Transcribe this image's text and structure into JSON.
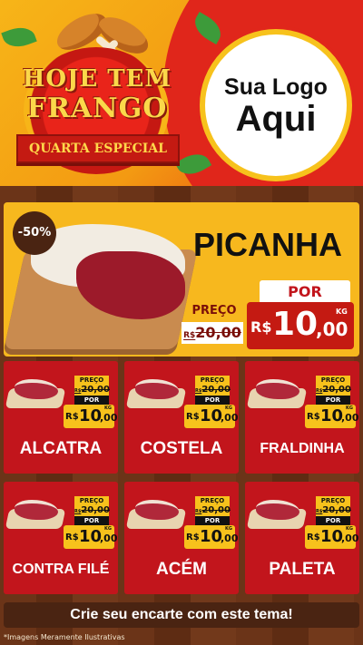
{
  "header": {
    "title_line1": "HOJE TEM",
    "title_line2": "FRANGO",
    "ribbon": "QUARTA ESPECIAL",
    "logo_line1": "Sua Logo",
    "logo_line2": "Aqui"
  },
  "featured": {
    "discount": "-50%",
    "name": "PICANHA",
    "por_label": "POR",
    "preco_label": "PREÇO",
    "old_currency": "R$",
    "old_price": "20,00",
    "currency": "R$",
    "price_int": "10",
    "price_dec": ",00",
    "unit": "KG"
  },
  "products": [
    {
      "name": "ALCATRA",
      "preco_label": "PREÇO",
      "old_currency": "R$",
      "old_price": "20,00",
      "por_label": "POR",
      "currency": "R$",
      "price_int": "10",
      "price_dec": ",00",
      "unit": "KG"
    },
    {
      "name": "COSTELA",
      "preco_label": "PREÇO",
      "old_currency": "R$",
      "old_price": "20,00",
      "por_label": "POR",
      "currency": "R$",
      "price_int": "10",
      "price_dec": ",00",
      "unit": "KG"
    },
    {
      "name": "FRALDINHA",
      "preco_label": "PREÇO",
      "old_currency": "R$",
      "old_price": "20,00",
      "por_label": "POR",
      "currency": "R$",
      "price_int": "10",
      "price_dec": ",00",
      "unit": "KG"
    },
    {
      "name": "CONTRA FILÉ",
      "preco_label": "PREÇO",
      "old_currency": "R$",
      "old_price": "20,00",
      "por_label": "POR",
      "currency": "R$",
      "price_int": "10",
      "price_dec": ",00",
      "unit": "KG"
    },
    {
      "name": "ACÉM",
      "preco_label": "PREÇO",
      "old_currency": "R$",
      "old_price": "20,00",
      "por_label": "POR",
      "currency": "R$",
      "price_int": "10",
      "price_dec": ",00",
      "unit": "KG"
    },
    {
      "name": "PALETA",
      "preco_label": "PREÇO",
      "old_currency": "R$",
      "old_price": "20,00",
      "por_label": "POR",
      "currency": "R$",
      "price_int": "10",
      "price_dec": ",00",
      "unit": "KG"
    }
  ],
  "footer": {
    "cta": "Crie seu encarte com este tema!",
    "disclaimer": "*Imagens Meramente Ilustrativas"
  },
  "colors": {
    "brand_red": "#c2151c",
    "brand_yellow": "#f7b81e",
    "wood_brown": "#6b3418"
  }
}
